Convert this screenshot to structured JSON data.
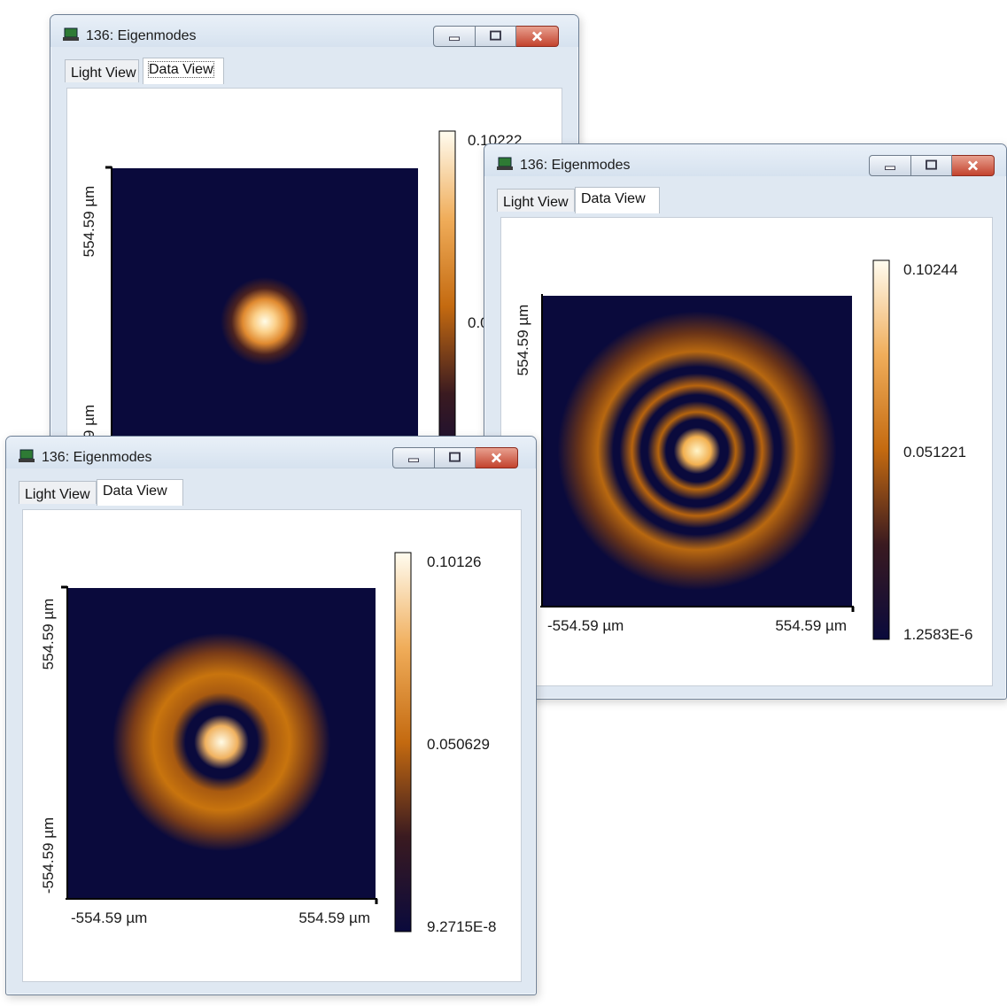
{
  "windows": [
    {
      "title": "136: Eigenmodes",
      "tabs": [
        "Light View",
        "Data View"
      ],
      "active_tab": "Data View",
      "plot": {
        "y_top_label": "554.59 µm",
        "y_bottom_label": "-554.59 µm",
        "colorbar": {
          "max": "0.10222",
          "mid": "0.0"
        }
      }
    },
    {
      "title": "136: Eigenmodes",
      "tabs": [
        "Light View",
        "Data View"
      ],
      "active_tab": "Data View",
      "plot": {
        "x_left_label": "-554.59 µm",
        "x_right_label": "554.59 µm",
        "y_top_label": "554.59 µm",
        "colorbar": {
          "max": "0.10244",
          "mid": "0.051221",
          "min": "1.2583E-6"
        }
      }
    },
    {
      "title": "136: Eigenmodes",
      "tabs": [
        "Light View",
        "Data View"
      ],
      "active_tab": "Data View",
      "plot": {
        "x_left_label": "-554.59 µm",
        "x_right_label": "554.59 µm",
        "y_top_label": "554.59 µm",
        "y_bottom_label": "-554.59 µm",
        "colorbar": {
          "max": "0.10126",
          "mid": "0.050629",
          "min": "9.2715E-8"
        }
      }
    }
  ],
  "colors": {
    "field_background": "#0a0a3c",
    "colormap": [
      "#0a0a3c",
      "#3a1a20",
      "#b05810",
      "#e88a2a",
      "#fbd9a2",
      "#fffae6"
    ]
  }
}
